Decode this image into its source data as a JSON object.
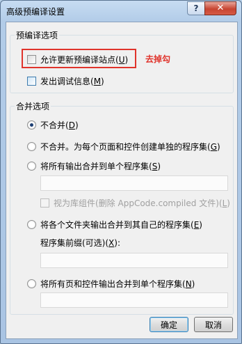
{
  "window": {
    "title": "高级预编译设置",
    "help_label": "?",
    "close_label": "✕"
  },
  "group1": {
    "legend": "预编译选项",
    "allow_updatable": {
      "label": "允许更新预编译站点(",
      "key": "U",
      "suffix": ")",
      "checked": false
    },
    "emit_debug": {
      "label": "发出调试信息(",
      "key": "M",
      "suffix": ")",
      "checked": false
    },
    "annotation": "去掉勾"
  },
  "group2": {
    "legend": "合并选项",
    "opt_no_merge": {
      "label": "不合并(",
      "key": "D",
      "suffix": ")",
      "selected": true
    },
    "opt_per_page": {
      "label": "不合并。为每个页面和控件创建单独的程序集(",
      "key": "G",
      "suffix": ")",
      "selected": false
    },
    "opt_merge_all": {
      "label": "将所有输出合并到单个程序集(",
      "key": "S",
      "suffix": ")",
      "selected": false
    },
    "merge_all_value": "",
    "treat_as_library": {
      "label": "视为库组件(删除 AppCode.compiled 文件)(",
      "key": "L",
      "suffix": ")",
      "checked": false
    },
    "opt_per_folder": {
      "label": "将各个文件夹输出合并到其自己的程序集(",
      "key": "E",
      "suffix": ")",
      "selected": false
    },
    "prefix_label": {
      "label": "程序集前缀(可选)(",
      "key": "X",
      "suffix": "):"
    },
    "prefix_value": "",
    "opt_pages_controls": {
      "label": "将所有页和控件输出合并到单个程序集(",
      "key": "N",
      "suffix": ")",
      "selected": false
    },
    "pages_controls_value": ""
  },
  "buttons": {
    "ok": "确定",
    "cancel": "取消"
  }
}
